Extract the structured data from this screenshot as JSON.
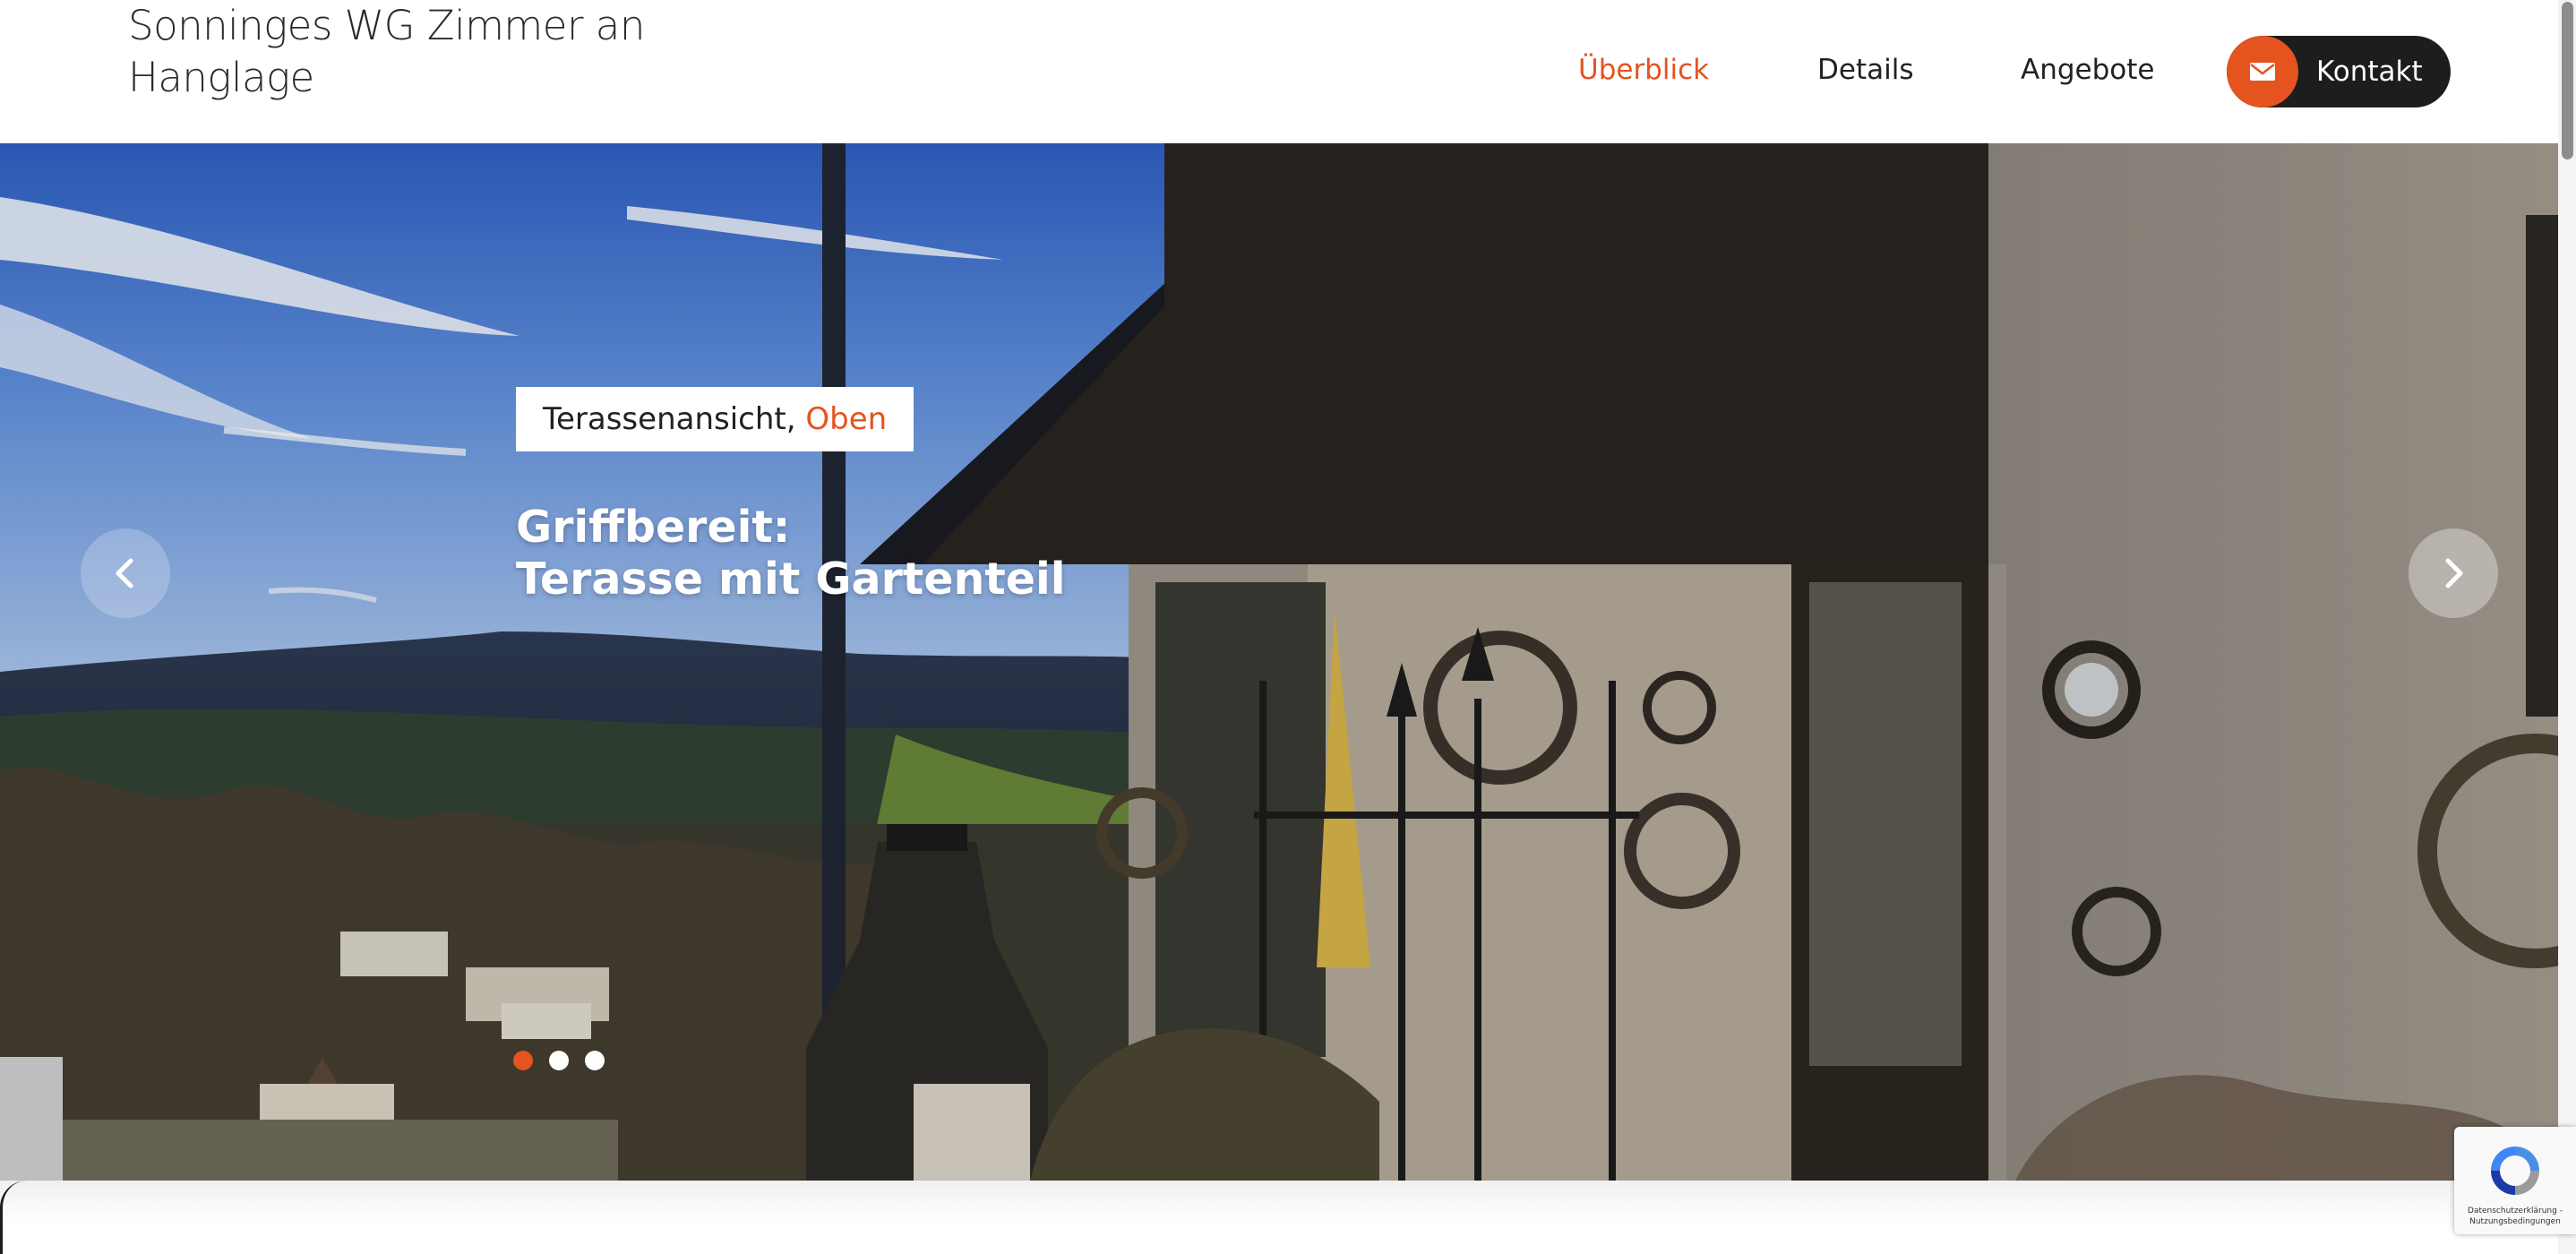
{
  "header": {
    "site_title": "Sonninges WG Zimmer an Hanglage",
    "nav": {
      "ueberblick": "Überblick",
      "details": "Details",
      "angebote": "Angebote"
    },
    "contact_button": {
      "label": "Kontakt",
      "icon": "envelope-icon"
    }
  },
  "hero": {
    "caption": {
      "text": "Terassenansicht, ",
      "accent": "Oben"
    },
    "heading_line1": "Griffbereit:",
    "heading_line2": "Terasse mit Gartenteil",
    "prev_icon": "chevron-left-icon",
    "next_icon": "chevron-right-icon",
    "slides_total": 3,
    "active_slide": 1
  },
  "recaptcha": {
    "terms": "Datenschutzerklärung - Nutzungsbedingungen"
  },
  "colors": {
    "accent": "#e5531f",
    "dark": "#1d1d1d",
    "text": "#222222",
    "white": "#ffffff"
  }
}
